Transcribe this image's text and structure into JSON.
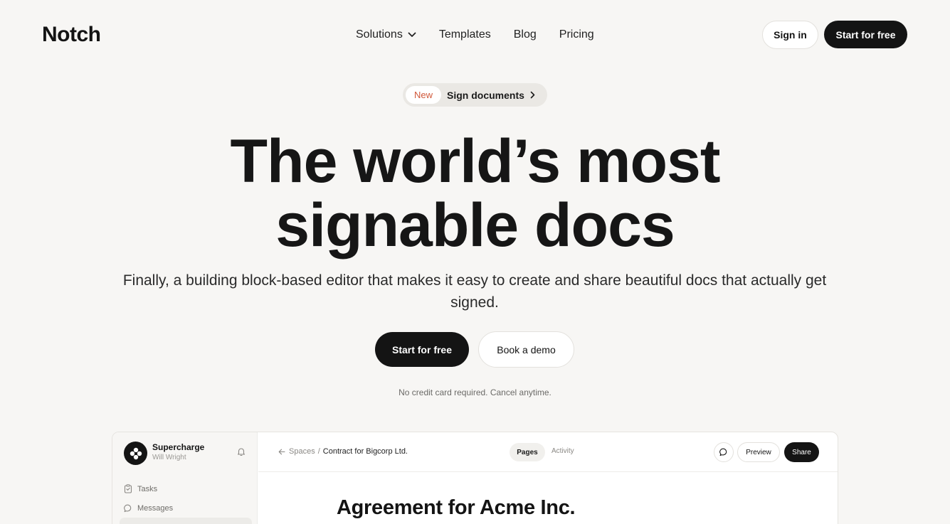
{
  "header": {
    "logo": "Notch",
    "nav": [
      {
        "label": "Solutions",
        "has_dropdown": true
      },
      {
        "label": "Templates"
      },
      {
        "label": "Blog"
      },
      {
        "label": "Pricing"
      }
    ],
    "sign_in": "Sign in",
    "start_free": "Start for free"
  },
  "announcement": {
    "badge": "New",
    "text": "Sign documents"
  },
  "hero": {
    "headline_line1": "The world’s most",
    "headline_line2": "signable docs",
    "subheadline": "Finally, a building block-based editor that makes it easy to create and share beautiful docs that actually get signed.",
    "primary_cta": "Start for free",
    "secondary_cta": "Book a demo",
    "note": "No credit card required. Cancel anytime."
  },
  "app_preview": {
    "workspace_name": "Supercharge",
    "workspace_user": "Will Wright",
    "sidebar_items": [
      {
        "label": "Tasks",
        "icon": "clipboard-icon"
      },
      {
        "label": "Messages",
        "icon": "chat-bubble-icon"
      }
    ],
    "breadcrumb": {
      "parent": "Spaces",
      "separator": "/",
      "current": "Contract for Bigcorp Ltd."
    },
    "tabs": [
      {
        "label": "Pages",
        "active": true
      },
      {
        "label": "Activity",
        "active": false
      }
    ],
    "preview_button": "Preview",
    "share_button": "Share",
    "doc_title": "Agreement for Acme Inc."
  },
  "colors": {
    "background": "#f7f6f4",
    "primary_dark": "#141414",
    "badge_accent": "#d0583a"
  }
}
